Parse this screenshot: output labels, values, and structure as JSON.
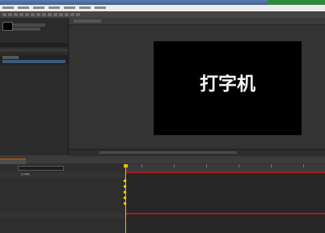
{
  "colors": {
    "accent": "#c06010",
    "playhead": "#e8c000",
    "layer_bar": "#9e1d1d",
    "keyframe": "#ffd000"
  },
  "comp": {
    "text": "打字机",
    "background": "#000000"
  },
  "timeline": {
    "layers": [
      {
        "name": "打字机"
      },
      {
        "name": ""
      }
    ]
  }
}
